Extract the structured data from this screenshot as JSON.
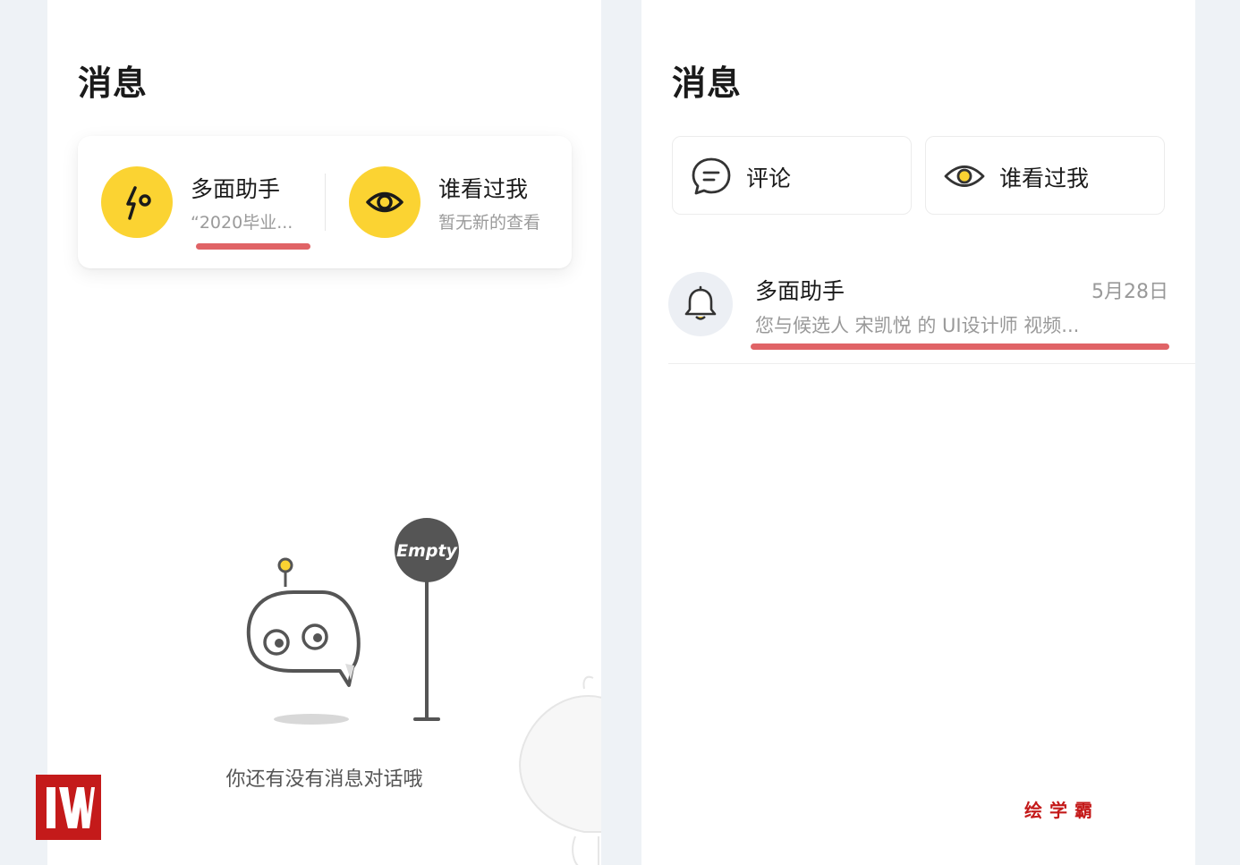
{
  "left": {
    "title": "消息",
    "cards": [
      {
        "title": "多面助手",
        "subtitle": "“2020毕业...",
        "icon": "assistant-bolt-icon"
      },
      {
        "title": "谁看过我",
        "subtitle": "暂无新的查看",
        "icon": "eye-icon"
      }
    ],
    "empty": {
      "badge": "Empty",
      "text": "你还有没有消息对话哦"
    }
  },
  "right": {
    "title": "消息",
    "tabs": [
      {
        "label": "评论",
        "icon": "comment-icon"
      },
      {
        "label": "谁看过我",
        "icon": "eye-icon"
      }
    ],
    "messages": [
      {
        "name": "多面助手",
        "date": "5月28日",
        "preview": "您与候选人 宋凯悦 的 UI设计师 视频...",
        "icon": "bell-icon"
      }
    ]
  },
  "watermark": {
    "brand": "绘学霸"
  },
  "colors": {
    "accent_yellow": "#fbd332",
    "highlight_red": "#e06366",
    "brand_red": "#c41a1a"
  }
}
